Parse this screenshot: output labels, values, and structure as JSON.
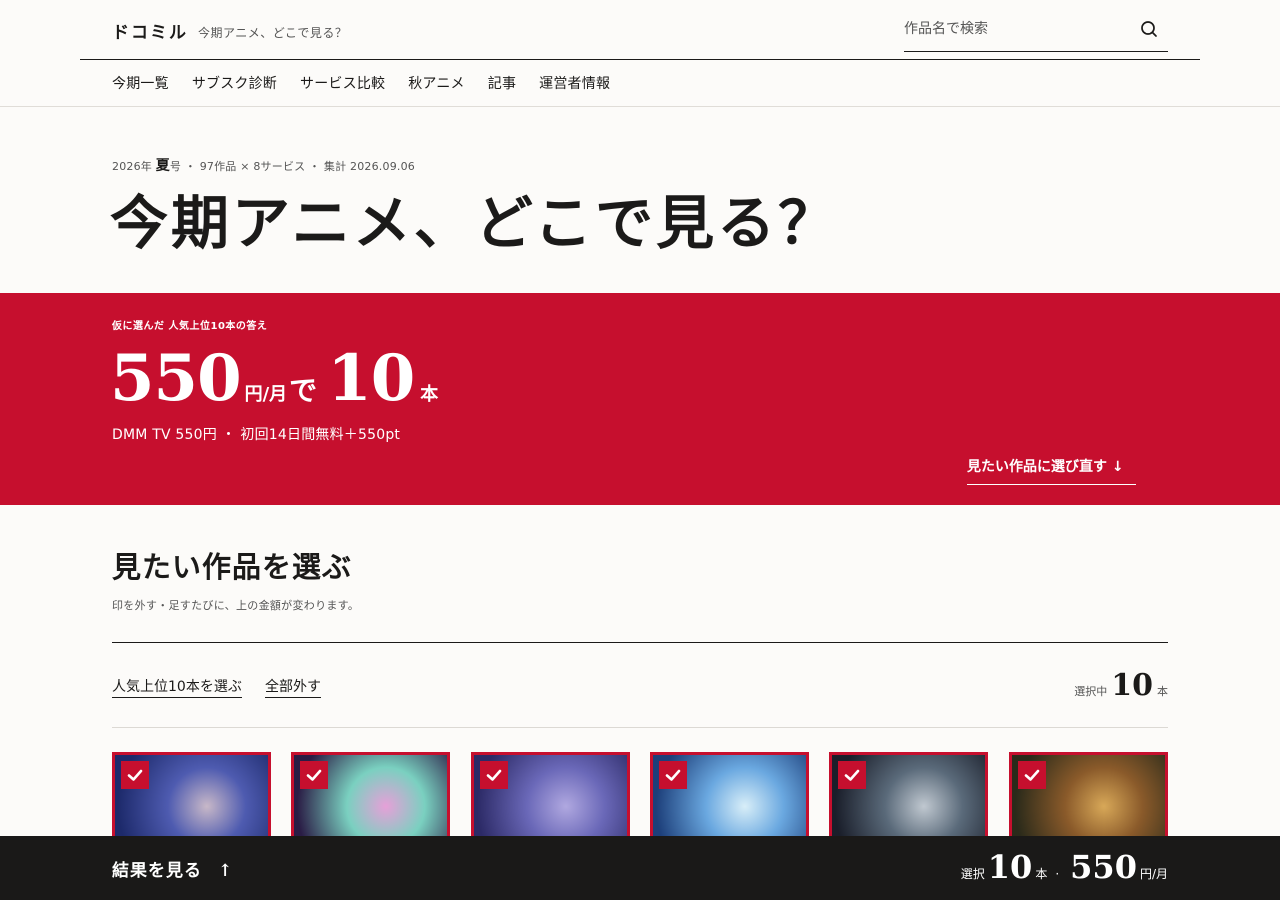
{
  "header": {
    "logo": "ドコミル",
    "tagline": "今期アニメ、どこで見る？",
    "search_placeholder": "作品名で検索"
  },
  "nav": {
    "items": [
      "今期一覧",
      "サブスク診断",
      "サービス比較",
      "秋アニメ",
      "記事",
      "運営者情報"
    ]
  },
  "hero": {
    "meta_year": "2026年",
    "meta_season": "夏",
    "meta_issue": "号",
    "meta_rest": "・ 97作品 × 8サービス ・ 集計 2026.09.06",
    "title": "今期アニメ、どこで見る？"
  },
  "band": {
    "kicker": "仮に選んだ 人気上位10本の答え",
    "price": "550",
    "price_unit": "円/月",
    "de": "で",
    "count": "10",
    "count_unit": "本",
    "sub": "DMM TV 550円 ・ 初回14日間無料＋550pt",
    "reselect": "見たい作品に選び直す ↓"
  },
  "select": {
    "title": "見たい作品を選ぶ",
    "sub": "印を外す・足すたびに、上の金額が変わります。",
    "top10_label": "人気上位10本を選ぶ",
    "clear_label": "全部外す",
    "selected_label": "選択中",
    "selected_count": "10",
    "selected_unit": "本"
  },
  "cards": [
    {
      "checked": true,
      "colors": [
        "#1d2a6b",
        "#4e5bb0",
        "#c8b8c8"
      ]
    },
    {
      "checked": true,
      "colors": [
        "#2a1c45",
        "#7ad0c0",
        "#e6a0d8"
      ]
    },
    {
      "checked": true,
      "colors": [
        "#2c2a66",
        "#6a68b8",
        "#b0a8e0"
      ]
    },
    {
      "checked": true,
      "colors": [
        "#1d3f7a",
        "#6aa8e0",
        "#d8eef8"
      ]
    },
    {
      "checked": true,
      "colors": [
        "#1a1e2a",
        "#5a6a7a",
        "#c0c8d0"
      ]
    },
    {
      "checked": true,
      "colors": [
        "#2a2a1a",
        "#8a5a2a",
        "#d8a858"
      ]
    }
  ],
  "bottom": {
    "results_label": "結果を見る",
    "results_arrow": "↑",
    "selected_label": "選択",
    "count": "10",
    "count_unit": "本",
    "dot": "·",
    "price": "550",
    "price_unit": "円/月"
  },
  "colors": {
    "accent": "#c60f2e",
    "background": "#fcfbf9",
    "dark": "#1a1918"
  }
}
